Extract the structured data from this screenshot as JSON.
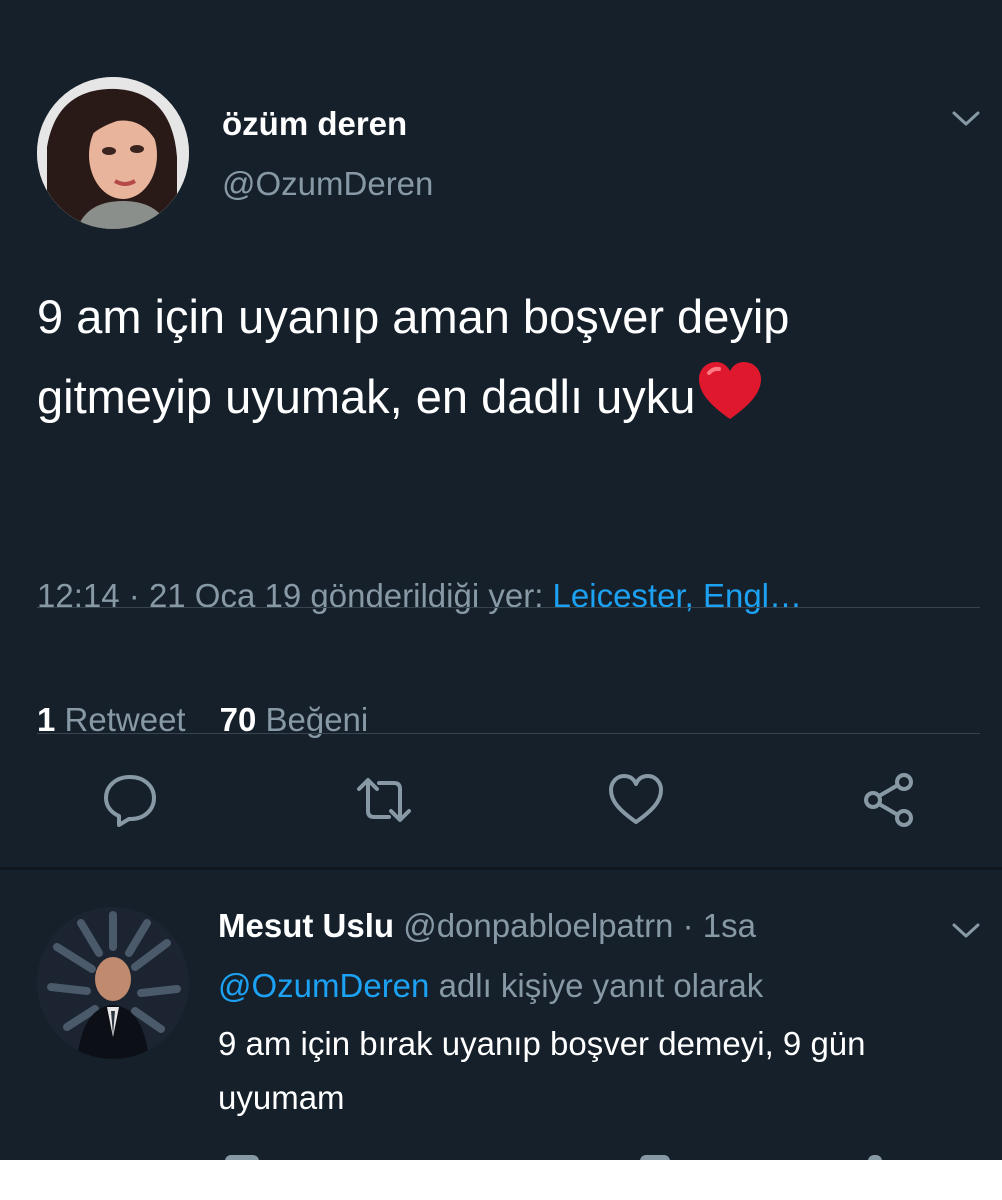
{
  "tweet": {
    "author": {
      "display_name": "özüm deren",
      "handle": "@OzumDeren"
    },
    "text": "9 am için uyanıp aman boşver deyip gitmeyip uyumak, en dadlı uyku",
    "emoji": "red-heart",
    "time": "12:14",
    "date": "21 Oca 19",
    "location_prefix": "gönderildiği yer:",
    "location": "Leicester, Engl…",
    "stats": {
      "retweet_count": "1",
      "retweet_label": "Retweet",
      "like_count": "70",
      "like_label": "Beğeni"
    },
    "actions": [
      {
        "icon": "reply-icon"
      },
      {
        "icon": "retweet-icon"
      },
      {
        "icon": "like-icon"
      },
      {
        "icon": "share-icon"
      }
    ]
  },
  "reply": {
    "author": {
      "display_name": "Mesut Uslu",
      "handle": "@donpabloelpatrn"
    },
    "time_ago": "1sa",
    "replying_to_handle": "@OzumDeren",
    "replying_to_suffix": "adlı kişiye yanıt olarak",
    "text": "9 am için bırak uyanıp boşver demeyi, 9 gün uyumam"
  },
  "colors": {
    "background": "#15202b",
    "text_primary": "#ffffff",
    "text_secondary": "#8899a6",
    "accent": "#1da1f2",
    "divider": "#38444d"
  }
}
